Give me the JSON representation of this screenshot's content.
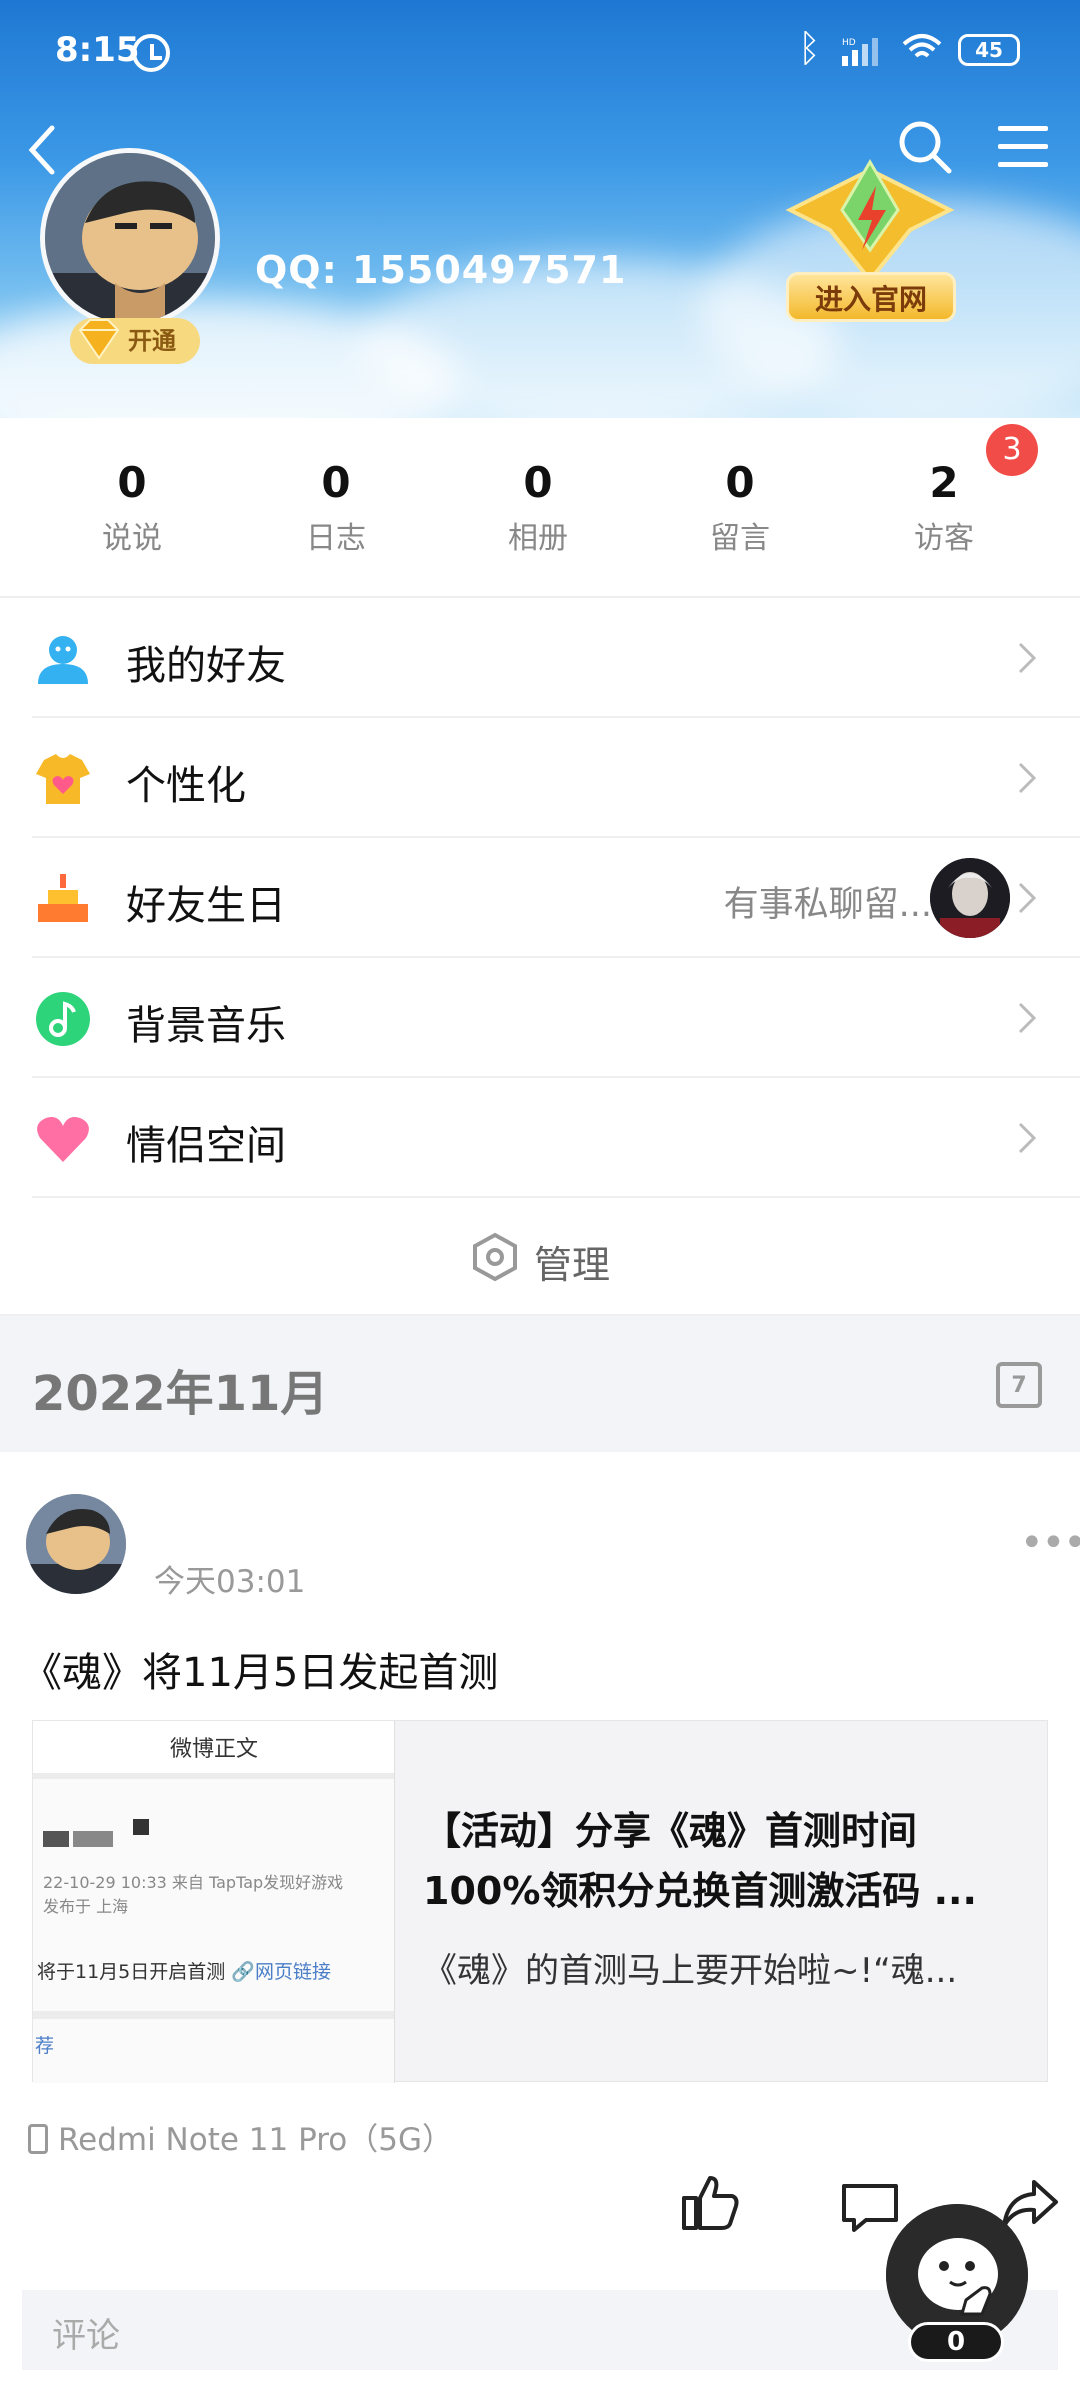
{
  "status_bar": {
    "time": "8:15",
    "network": "HD",
    "battery": "45"
  },
  "profile": {
    "qq_label": "QQ: 1550497571",
    "vip_label": "开通",
    "official_site_label": "进入官网"
  },
  "stats": [
    {
      "value": "0",
      "label": "说说"
    },
    {
      "value": "0",
      "label": "日志"
    },
    {
      "value": "0",
      "label": "相册"
    },
    {
      "value": "0",
      "label": "留言"
    },
    {
      "value": "2",
      "label": "访客"
    }
  ],
  "visitor_badge": "3",
  "menu": [
    {
      "label": "我的好友",
      "icon": "friends-icon"
    },
    {
      "label": "个性化",
      "icon": "personalize-icon"
    },
    {
      "label": "好友生日",
      "icon": "birthday-cake-icon",
      "extra": "有事私聊留..."
    },
    {
      "label": "背景音乐",
      "icon": "music-icon"
    },
    {
      "label": "情侣空间",
      "icon": "heart-icon"
    }
  ],
  "manage_label": "管理",
  "month_label": "2022年11月",
  "calendar_day": "7",
  "post": {
    "time": "今天03:01",
    "title": "《魂》将11月5日发起首测",
    "card_title": "【活动】分享《魂》首测时间100%领积分兑换首测激活码 ...",
    "card_desc": "《魂》的首测马上要开始啦~!“魂...",
    "thumb_header": "微博正文",
    "thumb_line1": "22-10-29 10:33   来自 TapTap发现好游戏",
    "thumb_line2": "发布于 上海",
    "thumb_line3": "将于11月5日开启首测",
    "thumb_link": "网页链接",
    "thumb_line4": "荐",
    "device": "Redmi Note 11 Pro（5G）",
    "comment_placeholder": "评论"
  },
  "floating_count": "0",
  "colors": {
    "header_top": "#1e78d3",
    "badge_red": "#f24c48",
    "link_blue": "#4b7ec7"
  }
}
